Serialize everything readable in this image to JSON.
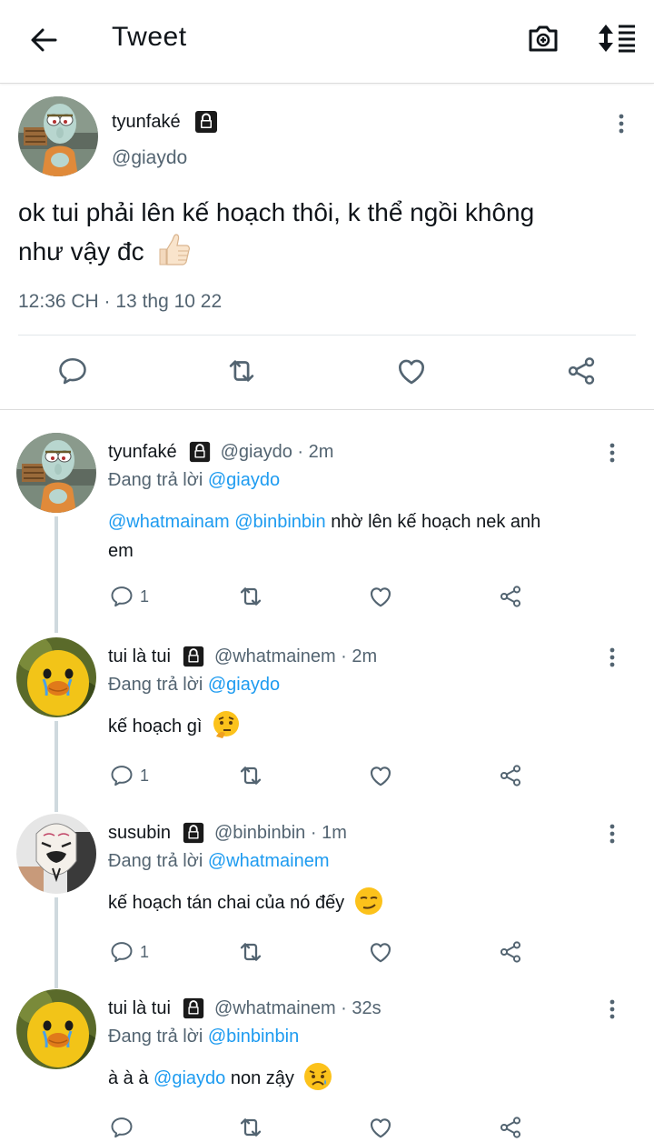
{
  "header": {
    "title": "Tweet",
    "icons": [
      "back-arrow-icon",
      "camera-icon",
      "sort-icon"
    ]
  },
  "main_tweet": {
    "name": "tyunfaké",
    "handle": "@giaydo",
    "text_line1": "ok tui phải lên kế hoạch thôi,  k thể ngồi không",
    "text_line2": "như vậy đc",
    "emoji": "thumbs-up",
    "timestamp": "12:36 CH · 13 thg 10 22"
  },
  "replies": [
    {
      "name": "tyunfaké",
      "meta": "@giaydo · 2m",
      "replying_label": "Đang trả lời",
      "replying_to": "@giaydo",
      "mention1": "@whatmainam",
      "mention2": "@binbinbin",
      "text_line1": "nhờ lên kế hoạch nek anh",
      "text_line2": "em",
      "reply_count": "1"
    },
    {
      "name": "tui là tui",
      "meta": "@whatmainem · 2m",
      "replying_label": "Đang trả lời",
      "replying_to": "@giaydo",
      "text": "kế hoạch gì",
      "emoji": "thinking-face",
      "reply_count": "1"
    },
    {
      "name": "susubin",
      "meta": "@binbinbin · 1m",
      "replying_label": "Đang trả lời",
      "replying_to": "@whatmainem",
      "text": "kế hoạch tán chai của nó đếy",
      "emoji": "smirking-face",
      "reply_count": "1"
    },
    {
      "name": "tui là tui",
      "meta": "@whatmainem · 32s",
      "replying_label": "Đang trả lời",
      "replying_to": "@binbinbin",
      "text_before": "à à à",
      "mention": "@giaydo",
      "text_after": "non zậy",
      "emoji": "sad-face"
    }
  ],
  "colors": {
    "link": "#1d9bf0",
    "secondary_text": "#536471",
    "primary_text": "#0f1419",
    "thread_line": "#cfd9de"
  }
}
